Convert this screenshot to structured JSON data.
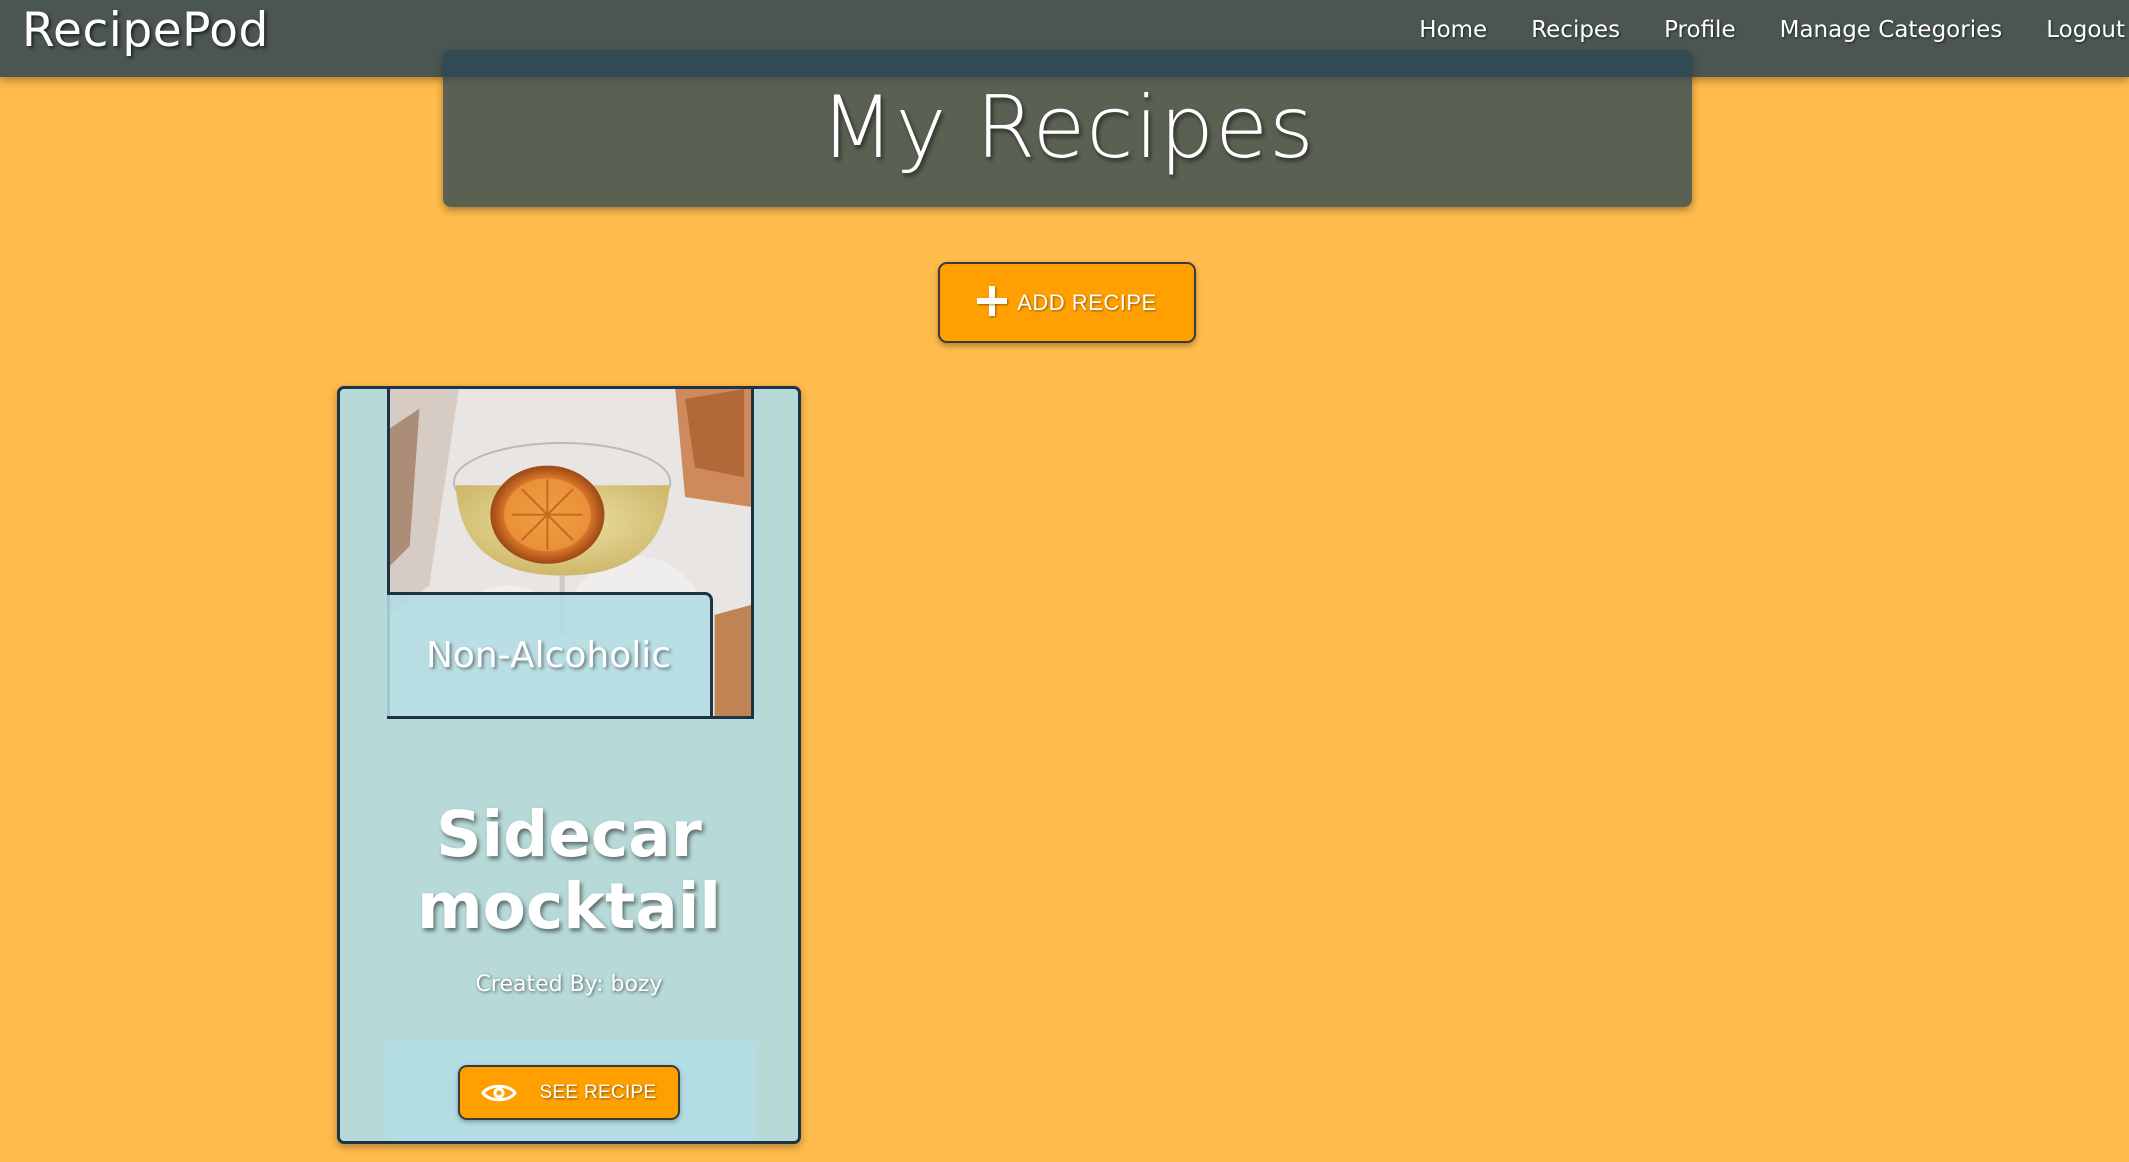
{
  "navbar": {
    "brand": "RecipePod",
    "links": [
      {
        "label": "Home"
      },
      {
        "label": "Recipes"
      },
      {
        "label": "Profile"
      },
      {
        "label": "Manage Categories"
      },
      {
        "label": "Logout"
      }
    ]
  },
  "page": {
    "title": "My Recipes",
    "add_button_label": "ADD RECIPE",
    "add_button_icon": "plus-icon"
  },
  "recipes": [
    {
      "category": "Non-Alcoholic",
      "title": "Sidecar mocktail",
      "created_by": "Created By: bozy",
      "image_subject": "cocktail glass with dried orange slice",
      "see_button_label": "SEE RECIPE",
      "see_button_icon": "eye-icon"
    }
  ],
  "colors": {
    "page_background": "#ffbb4b",
    "navbar": "#4b5651",
    "accent_button": "#ffa000",
    "card": "#b7dad8",
    "card_border": "#1d3348"
  }
}
